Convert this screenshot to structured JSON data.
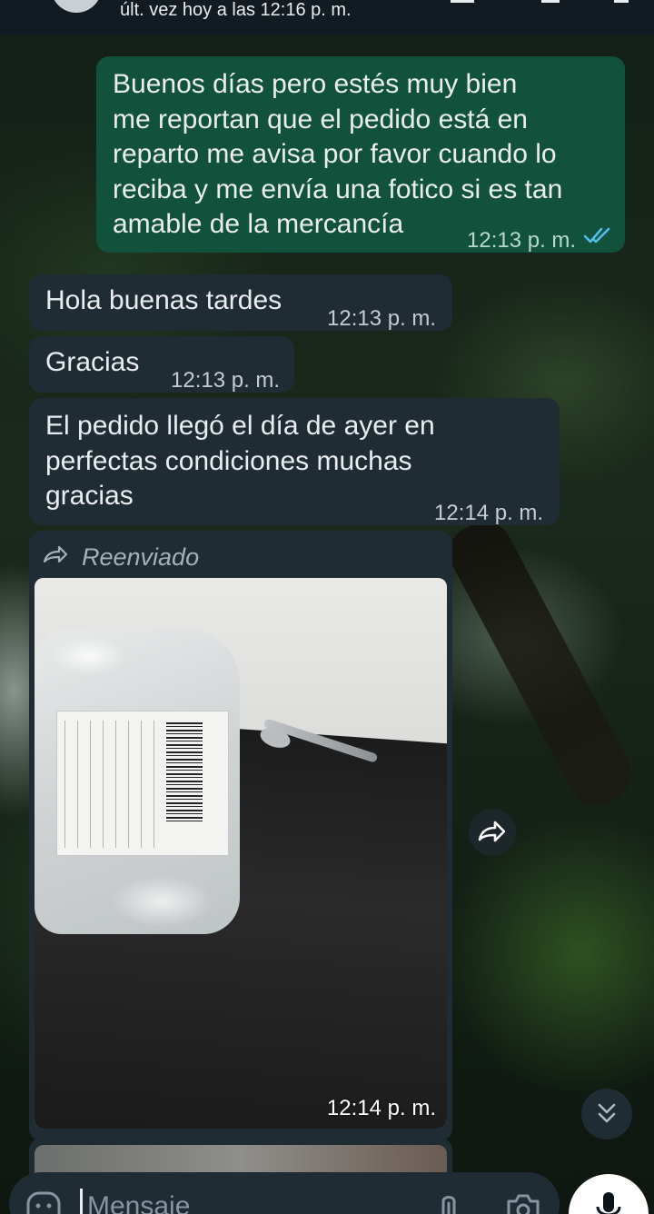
{
  "header": {
    "status": "últ. vez hoy a las 12:16 p. m."
  },
  "messages": [
    {
      "direction": "outgoing",
      "lines": [
        "Buenos días pero estés muy bien",
        "me reportan que el pedido está en",
        "reparto me avisa por favor cuando lo",
        "reciba y me envía una fotico si es tan",
        "amable de la mercancía"
      ],
      "time": "12:13 p. m.",
      "read_status": "read-double-check"
    },
    {
      "direction": "incoming",
      "lines": [
        "Hola buenas tardes"
      ],
      "time": "12:13 p. m."
    },
    {
      "direction": "incoming",
      "lines": [
        "Gracias"
      ],
      "time": "12:13 p. m."
    },
    {
      "direction": "incoming",
      "lines": [
        "El pedido llegó el día de ayer en",
        "perfectas condiciones muchas",
        "gracias"
      ],
      "time": "12:14 p. m."
    },
    {
      "direction": "incoming",
      "type": "forwarded-image",
      "forwarded_label": "Reenviado",
      "time": "12:14 p. m."
    }
  ],
  "composer": {
    "placeholder": "Mensaje"
  },
  "icons": {
    "read_receipt": "double-check-icon",
    "forward": "forward-icon",
    "share": "share-forward-icon",
    "scroll": "double-chevron-down-icon",
    "emoji": "emoji-icon",
    "attach": "paperclip-icon",
    "camera": "camera-icon",
    "mic": "mic-icon"
  },
  "colors": {
    "outgoing_bubble": "#12523c",
    "incoming_bubble": "#1f2c34",
    "read_ticks": "#53bdeb"
  }
}
